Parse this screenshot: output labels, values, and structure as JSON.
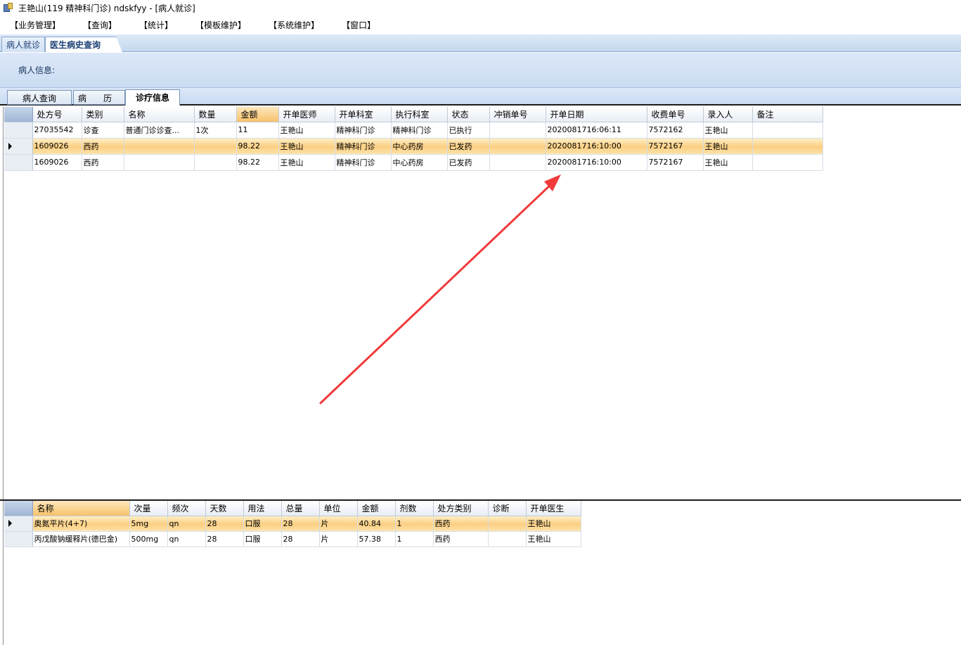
{
  "window": {
    "title": "王艳山(119 精神科门诊) ndskfyy - [病人就诊]"
  },
  "menu": [
    "【业务管理】",
    "【查询】",
    "【统计】",
    "【模板维护】",
    "【系统维护】",
    "【窗口】"
  ],
  "doc_tabs": {
    "inactive": "病人就诊",
    "active": "医生病史查询"
  },
  "patient_panel": {
    "label": "病人信息:"
  },
  "sub_tabs": {
    "t1": "病人查询",
    "t2": "病　　历",
    "t3": "诊疗信息"
  },
  "grid_orders": {
    "columns": [
      "处方号",
      "类别",
      "名称",
      "数量",
      "金额",
      "开单医师",
      "开单科室",
      "执行科室",
      "状态",
      "冲销单号",
      "开单日期",
      "收费单号",
      "录入人",
      "备注"
    ],
    "rows": [
      [
        "27035542",
        "诊查",
        "普通门诊诊查...",
        "1次",
        "11",
        "王艳山",
        "精神科门诊",
        "精神科门诊",
        "已执行",
        "",
        "2020081716:06:11",
        "7572162",
        "王艳山",
        ""
      ],
      [
        "1609026",
        "西药",
        "",
        "",
        "98.22",
        "王艳山",
        "精神科门诊",
        "中心药房",
        "已发药",
        "",
        "2020081716:10:00",
        "7572167",
        "王艳山",
        ""
      ],
      [
        "1609026",
        "西药",
        "",
        "",
        "98.22",
        "王艳山",
        "精神科门诊",
        "中心药房",
        "已发药",
        "",
        "2020081716:10:00",
        "7572167",
        "王艳山",
        ""
      ]
    ]
  },
  "grid_details": {
    "columns": [
      "名称",
      "次量",
      "频次",
      "天数",
      "用法",
      "总量",
      "单位",
      "金额",
      "剂数",
      "处方类别",
      "诊断",
      "开单医生"
    ],
    "rows": [
      [
        "奥氮平片(4+7)",
        "5mg",
        "qn",
        "28",
        "口服",
        "28",
        "片",
        "40.84",
        "1",
        "西药",
        "",
        "王艳山"
      ],
      [
        "丙戊酸钠缓释片(德巴金)",
        "500mg",
        "qn",
        "28",
        "口服",
        "28",
        "片",
        "57.38",
        "1",
        "西药",
        "",
        "王艳山"
      ]
    ]
  },
  "colors": {
    "annotation_arrow": "#f03a3a",
    "selected_row": "#fbcf83"
  }
}
